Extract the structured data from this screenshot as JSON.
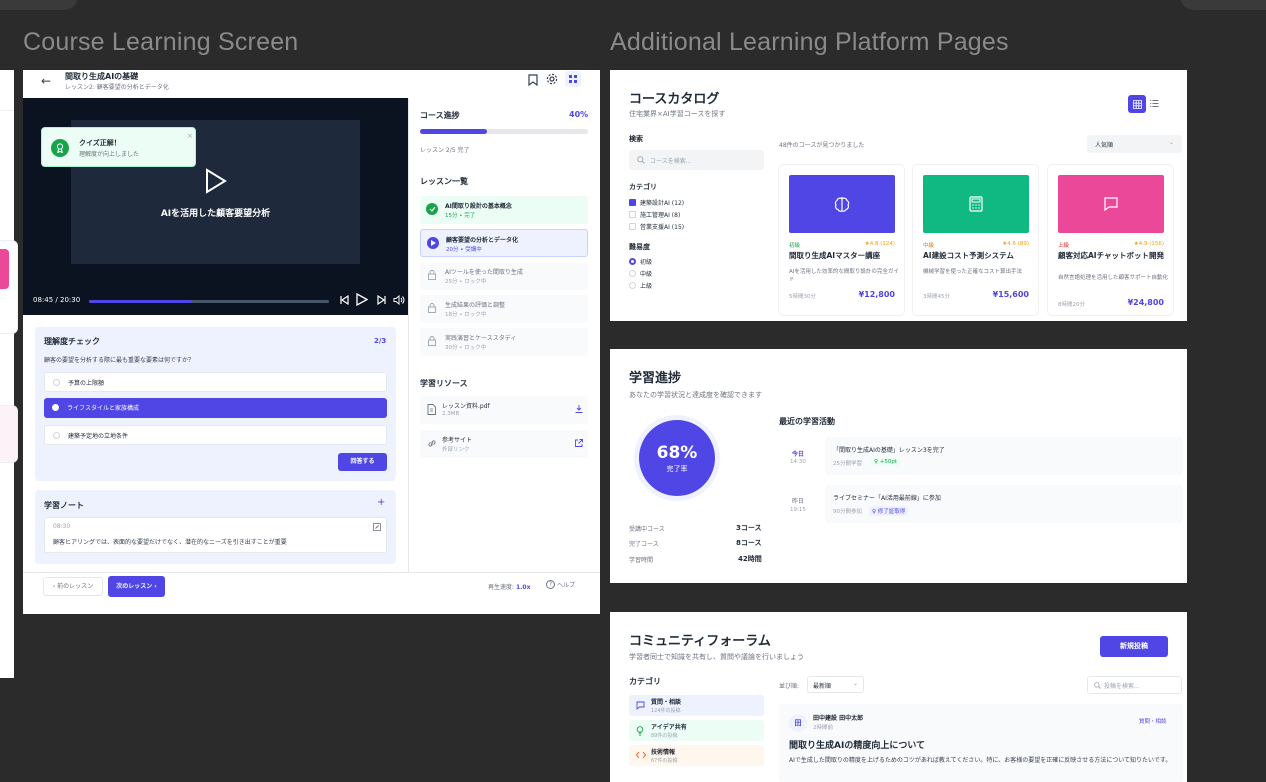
{
  "canvas": {
    "left_heading": "Course Learning Screen",
    "right_heading": "Additional Learning Platform Pages"
  },
  "course": {
    "title": "間取り生成AIの基礎",
    "subtitle": "レッスン2: 顧客要望の分析とデータ化",
    "video": {
      "title": "AIを活用した顧客要望分析",
      "current_time": "08:45",
      "separator": "/",
      "total_time": "20:30",
      "progress": 0.43
    },
    "toast": {
      "title": "クイズ正解！",
      "body": "理解度が向上しました"
    },
    "quiz": {
      "title": "理解度チェック",
      "counter": "2/3",
      "question": "顧客の要望を分析する際に最も重要な要素は何ですか？",
      "options": [
        "予算の上限額",
        "ライフスタイルと家族構成",
        "建築予定地の立地条件"
      ],
      "selected_index": 1,
      "submit": "回答する"
    },
    "notes": {
      "title": "学習ノート",
      "add": "+",
      "time": "08:30",
      "text": "顧客ヒアリングでは、表面的な要望だけでなく、潜在的なニーズを引き出すことが重要"
    },
    "footer": {
      "prev": "前のレッスン",
      "next": "次のレッスン",
      "speed_label": "再生速度:",
      "speed_value": "1.0x",
      "help": "ヘルプ"
    },
    "progress": {
      "title": "コース進捗",
      "percent_label": "40%",
      "value": 0.4,
      "sub": "レッスン 2/5 完了"
    },
    "lessons": {
      "title": "レッスン一覧",
      "items": [
        {
          "name": "AI間取り設計の基本概念",
          "meta": "15分 • 完了",
          "state": "done"
        },
        {
          "name": "顧客要望の分析とデータ化",
          "meta": "20分 • 受講中",
          "state": "current"
        },
        {
          "name": "AIツールを使った間取り生成",
          "meta": "25分 • ロック中",
          "state": "locked"
        },
        {
          "name": "生成結果の評価と調整",
          "meta": "18分 • ロック中",
          "state": "locked"
        },
        {
          "name": "実践演習とケーススタディ",
          "meta": "30分 • ロック中",
          "state": "locked"
        }
      ]
    },
    "resources": {
      "title": "学習リソース",
      "items": [
        {
          "name": "レッスン資料.pdf",
          "meta": "2.3MB"
        },
        {
          "name": "参考サイト",
          "meta": "外部リンク"
        }
      ]
    }
  },
  "catalog": {
    "title": "コースカタログ",
    "subtitle": "住宅業界×AI学習コースを探す",
    "search_label": "検索",
    "search_placeholder": "コースを検索...",
    "result_count": "48件のコースが見つかりました",
    "sort": "人気順",
    "category_label": "カテゴリ",
    "categories": [
      "建築設計AI (12)",
      "施工管理AI (8)",
      "営業支援AI (15)"
    ],
    "level_label": "難易度",
    "levels": [
      "初級",
      "中級",
      "上級"
    ],
    "cards": [
      {
        "color": "#4f46e5",
        "icon": "brain-icon",
        "level": "初級",
        "level_color": "#16a34a",
        "rating": "★4.8 (124)",
        "title": "間取り生成AIマスター講座",
        "desc": "AIを活用した効率的な間取り設計の完全ガイド",
        "duration": "5時間30分",
        "price": "¥12,800"
      },
      {
        "color": "#10b981",
        "icon": "calculator-icon",
        "level": "中級",
        "level_color": "#d97706",
        "rating": "★4.6 (89)",
        "title": "AI建設コスト予測システム",
        "desc": "機械学習を使った正確なコスト算出手法",
        "duration": "3時間45分",
        "price": "¥15,600"
      },
      {
        "color": "#ec4899",
        "icon": "chat-icon",
        "level": "上級",
        "level_color": "#dc2626",
        "rating": "★4.9 (156)",
        "title": "顧客対応AIチャットボット開発",
        "desc": "自然言語処理を活用した顧客サポート自動化",
        "duration": "8時間20分",
        "price": "¥24,800"
      }
    ]
  },
  "learning": {
    "title": "学習進捗",
    "subtitle": "あなたの学習状況と達成度を確認できます",
    "percent": "68%",
    "percent_label": "完了率",
    "stats": [
      {
        "label": "受講中コース",
        "value": "3コース"
      },
      {
        "label": "完了コース",
        "value": "8コース"
      },
      {
        "label": "学習時間",
        "value": "42時間"
      }
    ],
    "recent_title": "最近の学習活動",
    "activities": [
      {
        "day": "今日",
        "time": "14:30",
        "title": "「間取り生成AIの基礎」レッスン3を完了",
        "meta": "25分間学習",
        "badge": "+50pt",
        "badge_color": "#16a34a"
      },
      {
        "day": "昨日",
        "time": "19:15",
        "title": "ライブセミナー「AI活用最前線」に参加",
        "meta": "90分間参加",
        "badge": "修了証取得",
        "badge_color": "#4f46e5"
      }
    ]
  },
  "forum": {
    "title": "コミュニティフォーラム",
    "subtitle": "学習者同士で知識を共有し、質問や議論を行いましょう",
    "new_post": "新規投稿",
    "category_label": "カテゴリ",
    "categories": [
      {
        "name": "質問・相談",
        "count": "124件の投稿",
        "bg": "#eef2ff",
        "color": "#4f46e5"
      },
      {
        "name": "アイデア共有",
        "count": "89件の投稿",
        "bg": "#ecfdf5",
        "color": "#16a34a"
      },
      {
        "name": "技術情報",
        "count": "67件の投稿",
        "bg": "#fff7ed",
        "color": "#ea580c"
      }
    ],
    "sort_label": "並び順:",
    "sort_value": "最新順",
    "search_placeholder": "投稿を検索...",
    "post": {
      "avatar": "田",
      "author": "田中建設 田中太郎",
      "time": "2時間前",
      "tag": "質問・相談",
      "title": "間取り生成AIの精度向上について",
      "body": "AIで生成した間取りの精度を上げるためのコツがあれば教えてください。特に、お客様の要望を正確に反映させる方法について知りたいです。"
    }
  }
}
